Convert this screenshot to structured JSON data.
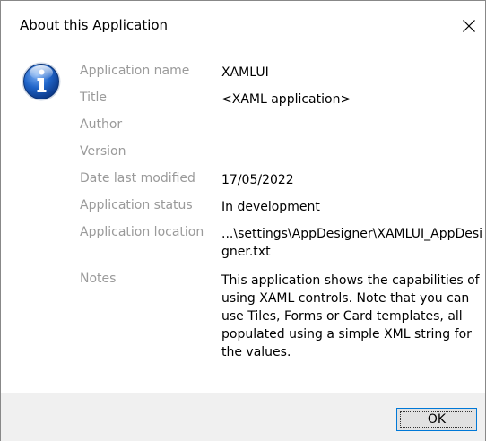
{
  "window": {
    "title": "About this Application",
    "close_icon": "close-icon"
  },
  "icon": {
    "name": "info-icon",
    "color": "#1c5fc2"
  },
  "properties": {
    "application_name": {
      "label": "Application name",
      "value": "XAMLUI"
    },
    "title": {
      "label": "Title",
      "value": "<XAML application>"
    },
    "author": {
      "label": "Author",
      "value": ""
    },
    "version": {
      "label": "Version",
      "value": ""
    },
    "date_last_modified": {
      "label": "Date last modified",
      "value": "17/05/2022"
    },
    "application_status": {
      "label": "Application status",
      "value": "In development"
    },
    "application_location": {
      "label": "Application location",
      "value": "...\\settings\\AppDesigner\\XAMLUI_AppDesigner.txt"
    },
    "notes": {
      "label": "Notes",
      "value": "This application shows the capabilities of using XAML controls. Note that you can use Tiles, Forms or Card templates, all populated using a simple XML string for the values."
    }
  },
  "footer": {
    "ok_label": "OK"
  }
}
